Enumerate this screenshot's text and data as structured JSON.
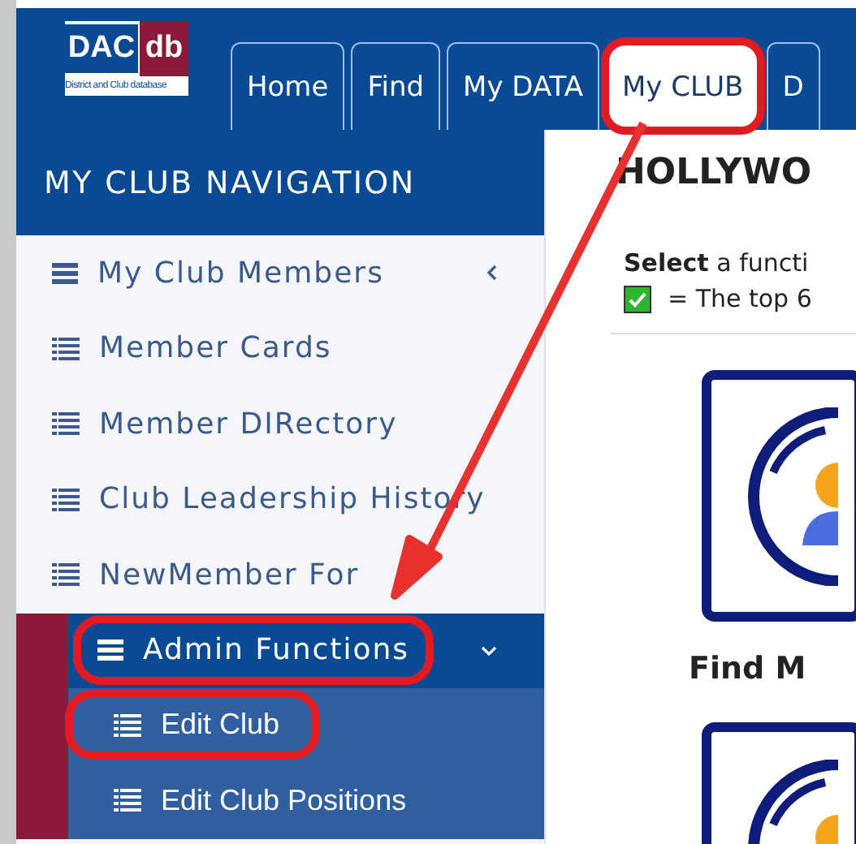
{
  "logo": {
    "title": "DAC",
    "badge": "db",
    "tagline": "District and Club database"
  },
  "tabs": [
    {
      "label": "Home",
      "selected": false,
      "highlighted": false
    },
    {
      "label": "Find",
      "selected": false,
      "highlighted": false
    },
    {
      "label": "My DATA",
      "selected": false,
      "highlighted": false
    },
    {
      "label": "My CLUB",
      "selected": true,
      "highlighted": true
    },
    {
      "label": "D",
      "selected": false,
      "highlighted": false
    }
  ],
  "sidebar": {
    "title": "MY CLUB NAVIGATION",
    "items": [
      {
        "kind": "group",
        "label": "My Club Members",
        "expanded": false,
        "highlighted": false
      },
      {
        "kind": "link",
        "label": "Member Cards",
        "highlighted": false
      },
      {
        "kind": "link",
        "label": "Member DIRectory",
        "highlighted": false
      },
      {
        "kind": "link",
        "label": "Club Leadership History",
        "highlighted": false
      },
      {
        "kind": "link",
        "label": "NewMember For",
        "highlighted": false
      },
      {
        "kind": "group",
        "label": "Admin Functions",
        "expanded": true,
        "highlighted": true,
        "children": [
          {
            "kind": "link",
            "label": "Edit Club",
            "highlighted": true
          },
          {
            "kind": "link",
            "label": "Edit Club Positions",
            "highlighted": false
          }
        ]
      }
    ]
  },
  "main": {
    "title": "HOLLYWO",
    "instruction": "**Select** a functi",
    "legend": {
      "checked": true,
      "text": "= The top 6"
    },
    "cards": [
      {
        "kind": "labeled",
        "label": "Find M"
      },
      {
        "kind": "tile"
      }
    ]
  }
}
